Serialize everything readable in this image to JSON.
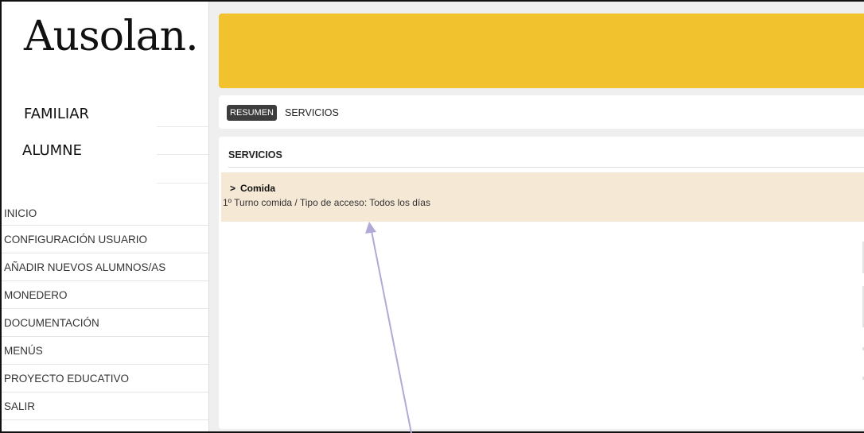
{
  "sidebar": {
    "logo": "Ausolan.",
    "roles": [
      "FAMILIAR",
      "ALUMNE"
    ],
    "menu": [
      "INICIO",
      "CONFIGURACIÓN USUARIO",
      "AÑADIR NUEVOS ALUMNOS/AS",
      "MONEDERO",
      "DOCUMENTACIÓN",
      "MENÚS",
      "PROYECTO EDUCATIVO",
      "SALIR"
    ]
  },
  "tabs": {
    "active": "RESUMEN",
    "other": "SERVICIOS"
  },
  "services": {
    "title": "SERVICIOS",
    "items": [
      {
        "name": "Comida",
        "description": "1º Turno comida / Tipo de acceso: Todos los días"
      }
    ]
  },
  "colors": {
    "banner": "#f2c12e",
    "service_row": "#f5e9d6",
    "active_tab": "#3d3d3d",
    "annotation_arrow": "#b3a9d6"
  },
  "icons": {
    "expand": "chevron-right-icon"
  }
}
